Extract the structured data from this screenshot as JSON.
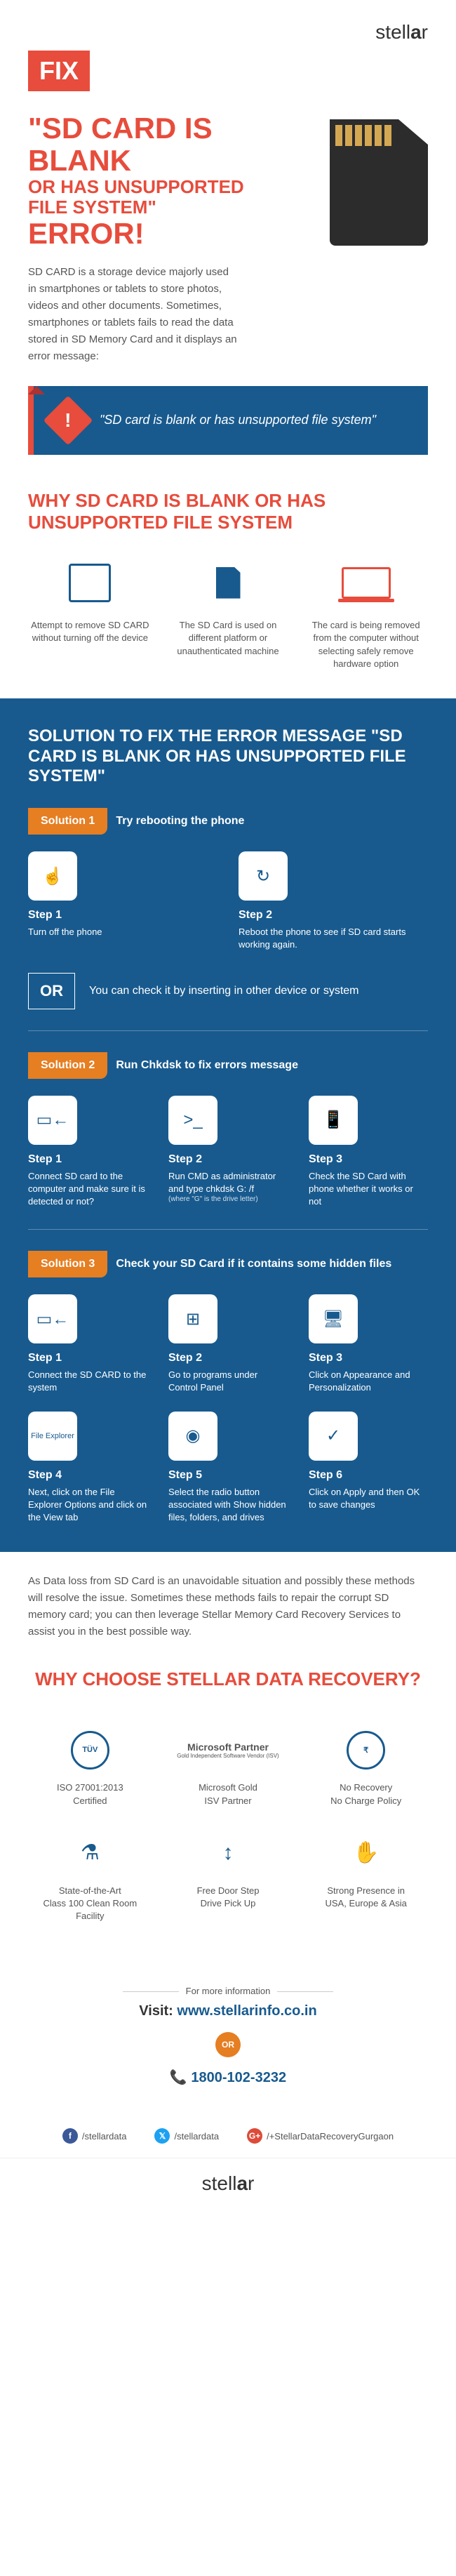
{
  "brand": "stellar",
  "fix_badge": "FIX",
  "title_line1": "\"SD CARD IS BLANK",
  "title_line2": "OR HAS UNSUPPORTED",
  "title_line3": "FILE SYSTEM\"",
  "title_line4": "ERROR!",
  "intro": "SD CARD is a storage device majorly used in smartphones or tablets to store photos, videos and other documents. Sometimes, smartphones or tablets fails to read the data stored in SD Memory Card and it displays an error message:",
  "error_msg": "\"SD card is blank or has unsupported file system\"",
  "why_heading": "WHY SD CARD IS BLANK OR HAS UNSUPPORTED FILE SYSTEM",
  "why_items": [
    "Attempt to remove SD CARD without turning off the device",
    "The SD Card is used on different platform or unauthenticated machine",
    "The card is being removed from the computer without selecting safely remove hardware option"
  ],
  "sol_title": "SOLUTION TO FIX THE ERROR MESSAGE \"SD CARD IS BLANK OR HAS UNSUPPORTED FILE SYSTEM\"",
  "sol1_label": "Solution 1",
  "sol1_head": "Try rebooting the phone",
  "sol1_steps": [
    {
      "label": "Step 1",
      "txt": "Turn off the phone"
    },
    {
      "label": "Step 2",
      "txt": "Reboot the phone to see if SD card starts working again."
    }
  ],
  "or_label": "OR",
  "or_txt": "You can check it by inserting in other device or system",
  "sol2_label": "Solution 2",
  "sol2_head": "Run Chkdsk to fix errors message",
  "sol2_steps": [
    {
      "label": "Step 1",
      "txt": "Connect SD card to the computer and make sure it is detected or not?"
    },
    {
      "label": "Step 2",
      "txt": "Run CMD as administrator and type chkdsk G: /f",
      "note": "(where \"G\" is the drive letter)"
    },
    {
      "label": "Step 3",
      "txt": "Check the SD Card with phone whether it works or not"
    }
  ],
  "sol3_label": "Solution 3",
  "sol3_head": "Check your SD Card if it contains some hidden files",
  "sol3_steps": [
    {
      "label": "Step 1",
      "txt": "Connect the SD CARD to the system"
    },
    {
      "label": "Step 2",
      "txt": "Go to programs under Control Panel"
    },
    {
      "label": "Step 3",
      "txt": "Click on Appearance and Personalization"
    },
    {
      "label": "Step 4",
      "txt": "Next, click on the File Explorer Options and click on the View tab"
    },
    {
      "label": "Step 5",
      "txt": "Select the radio button associated with Show hidden files, folders, and drives"
    },
    {
      "label": "Step 6",
      "txt": "Click on Apply and then OK to save changes"
    }
  ],
  "closing": "As Data loss from SD Card is an unavoidable situation and possibly these methods will resolve the issue. Sometimes these methods fails to repair the corrupt SD memory card; you can then leverage Stellar Memory Card Recovery Services to assist you in the best possible way.",
  "why_choose_h": "WHY CHOOSE STELLAR DATA RECOVERY?",
  "badges_r1": [
    {
      "main": "ISO 27001:2013",
      "sub": "Certified",
      "ic": "TÜV"
    },
    {
      "main": "Microsoft Gold",
      "sub": "ISV Partner",
      "ic": "MS"
    },
    {
      "main": "No Recovery",
      "sub": "No Charge Policy",
      "ic": "₹"
    }
  ],
  "badges_r2": [
    {
      "main": "State-of-the-Art",
      "sub": "Class 100 Clean Room Facility",
      "ic": "⚗"
    },
    {
      "main": "Free Door Step",
      "sub": "Drive Pick Up",
      "ic": "↕"
    },
    {
      "main": "Strong Presence in",
      "sub": "USA, Europe & Asia",
      "ic": "✋"
    }
  ],
  "more_info": "For more information",
  "visit_prefix": "Visit: ",
  "visit_url": "www.stellarinfo.co.in",
  "or_small": "OR",
  "phone": "1800-102-3232",
  "social": [
    {
      "net": "fb",
      "handle": "/stellardata",
      "g": "f"
    },
    {
      "net": "tw",
      "handle": "/stellardata",
      "g": "𝕏"
    },
    {
      "net": "gp",
      "handle": "/+StellarDataRecoveryGurgaon",
      "g": "G+"
    }
  ],
  "footer_brand": "stellar"
}
